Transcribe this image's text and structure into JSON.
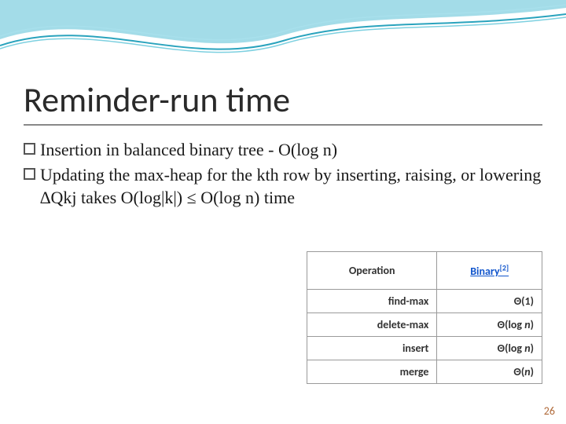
{
  "title": "Reminder-run time",
  "bullets": [
    "Insertion in balanced binary tree - O(log n)",
    "Updating the max-heap for the kth row by inserting, raising, or lowering ∆Qkj takes O(log|k|) ≤ O(log n) time"
  ],
  "table": {
    "headers": {
      "op": "Operation",
      "bin": "Binary",
      "bin_sup": "[2]"
    },
    "rows": [
      {
        "op": "find-max",
        "val": "Θ(1)"
      },
      {
        "op": "delete-max",
        "val_prefix": "Θ(log ",
        "val_ital": "n",
        "val_suffix": ")"
      },
      {
        "op": "insert",
        "val_prefix": "Θ(log ",
        "val_ital": "n",
        "val_suffix": ")"
      },
      {
        "op": "merge",
        "val_prefix": "Θ(",
        "val_ital": "n",
        "val_suffix": ")"
      }
    ]
  },
  "page_number": "26",
  "chart_data": {
    "type": "table",
    "title": "Heap operation complexities (Binary heap)",
    "columns": [
      "Operation",
      "Binary"
    ],
    "rows": [
      [
        "find-max",
        "Θ(1)"
      ],
      [
        "delete-max",
        "Θ(log n)"
      ],
      [
        "insert",
        "Θ(log n)"
      ],
      [
        "merge",
        "Θ(n)"
      ]
    ]
  }
}
